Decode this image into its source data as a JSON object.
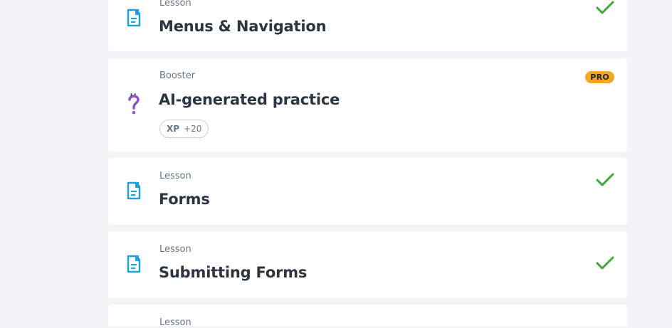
{
  "lessons": [
    {
      "type": "Lesson",
      "title": "Menus & Navigation",
      "completed": true
    },
    {
      "type": "Booster",
      "title": "AI-generated practice",
      "badge": "PRO",
      "xp_label": "XP",
      "xp_value": "+20",
      "icon": "question-mark-icon"
    },
    {
      "type": "Lesson",
      "title": "Forms",
      "completed": true
    },
    {
      "type": "Lesson",
      "title": "Submitting Forms",
      "completed": true
    },
    {
      "type": "Lesson"
    }
  ],
  "colors": {
    "background": "#f2f4f7",
    "card": "#ffffff",
    "lesson_icon": "#1ca0e3",
    "check": "#3fa63a",
    "pro_badge": "#f5a623",
    "booster_icon": "#8c4fd1"
  },
  "icons": {
    "lesson": "document-icon",
    "completed": "checkmark-icon",
    "booster": "question-mark-icon"
  }
}
